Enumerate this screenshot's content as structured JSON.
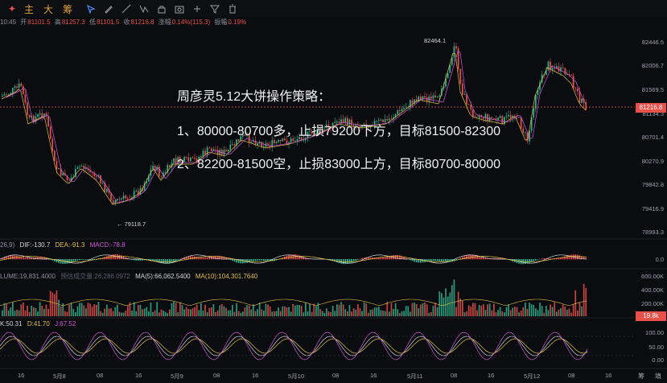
{
  "toolbar": {
    "items": [
      "主",
      "大",
      "筹"
    ],
    "icons": [
      "star-icon",
      "cursor-icon",
      "pencil-icon",
      "line-tool-icon",
      "fib-icon",
      "lock-icon",
      "camera-icon",
      "ruler-icon",
      "filter-icon",
      "trash-icon"
    ]
  },
  "info_bar": {
    "time": "10:45",
    "open_label": "开",
    "open": "81101.5",
    "high_label": "高",
    "high": "81257.3",
    "low_label": "低",
    "low": "81101.5",
    "close_label": "收",
    "close": "81216.8",
    "change_label": "涨幅",
    "change": "0.14%(115.3)",
    "amp_label": "振幅",
    "amp": "0.19%"
  },
  "price_axis": [
    "82446.5",
    "82006.7",
    "81569.5",
    "81134.3",
    "80701.4",
    "80270.9",
    "79842.8",
    "79416.9",
    "78993.3"
  ],
  "current_price": "81216.8",
  "annotations": {
    "high": "82464.1",
    "low": "← 79118.7"
  },
  "note": {
    "title": "周彦灵5.12大饼操作策略：",
    "line1": "1、80000-80700多，止损79200下方，目标81500-82300",
    "line2": "2、82200-81500空，止损83000上方，目标80700-80000"
  },
  "macd": {
    "params": "26,9)",
    "dif": "DIF:-130.7",
    "dea": "DEA:-91.3",
    "macd": "MACD:-78.8",
    "zero": "0.0"
  },
  "volume": {
    "label": "LUME:19,831.4000",
    "forecast": "预估成交量:26,286.0972",
    "ma5": "MA(5):66,062.5400",
    "ma10": "MA(10):104,301.7640",
    "ticks": [
      "600.00K",
      "400.00K",
      "200.00K"
    ],
    "current": "19.8k"
  },
  "kdj": {
    "k": "K:50.31",
    "d": "D:41.70",
    "j": "J:67.52",
    "ticks": [
      "100.00",
      "50.00",
      "0.00"
    ]
  },
  "x_axis": [
    "16",
    "5月8",
    "08",
    "16",
    "5月9",
    "08",
    "16",
    "5月10",
    "08",
    "16",
    "5月11",
    "08",
    "16",
    "5月12",
    "08",
    "16"
  ],
  "side_buttons": [
    "筹",
    "填"
  ],
  "colors": {
    "up": "#2fb38e",
    "down": "#e8504a",
    "bg": "#0b0c10",
    "yellow": "#e0c040",
    "pink": "#d05ad8"
  }
}
